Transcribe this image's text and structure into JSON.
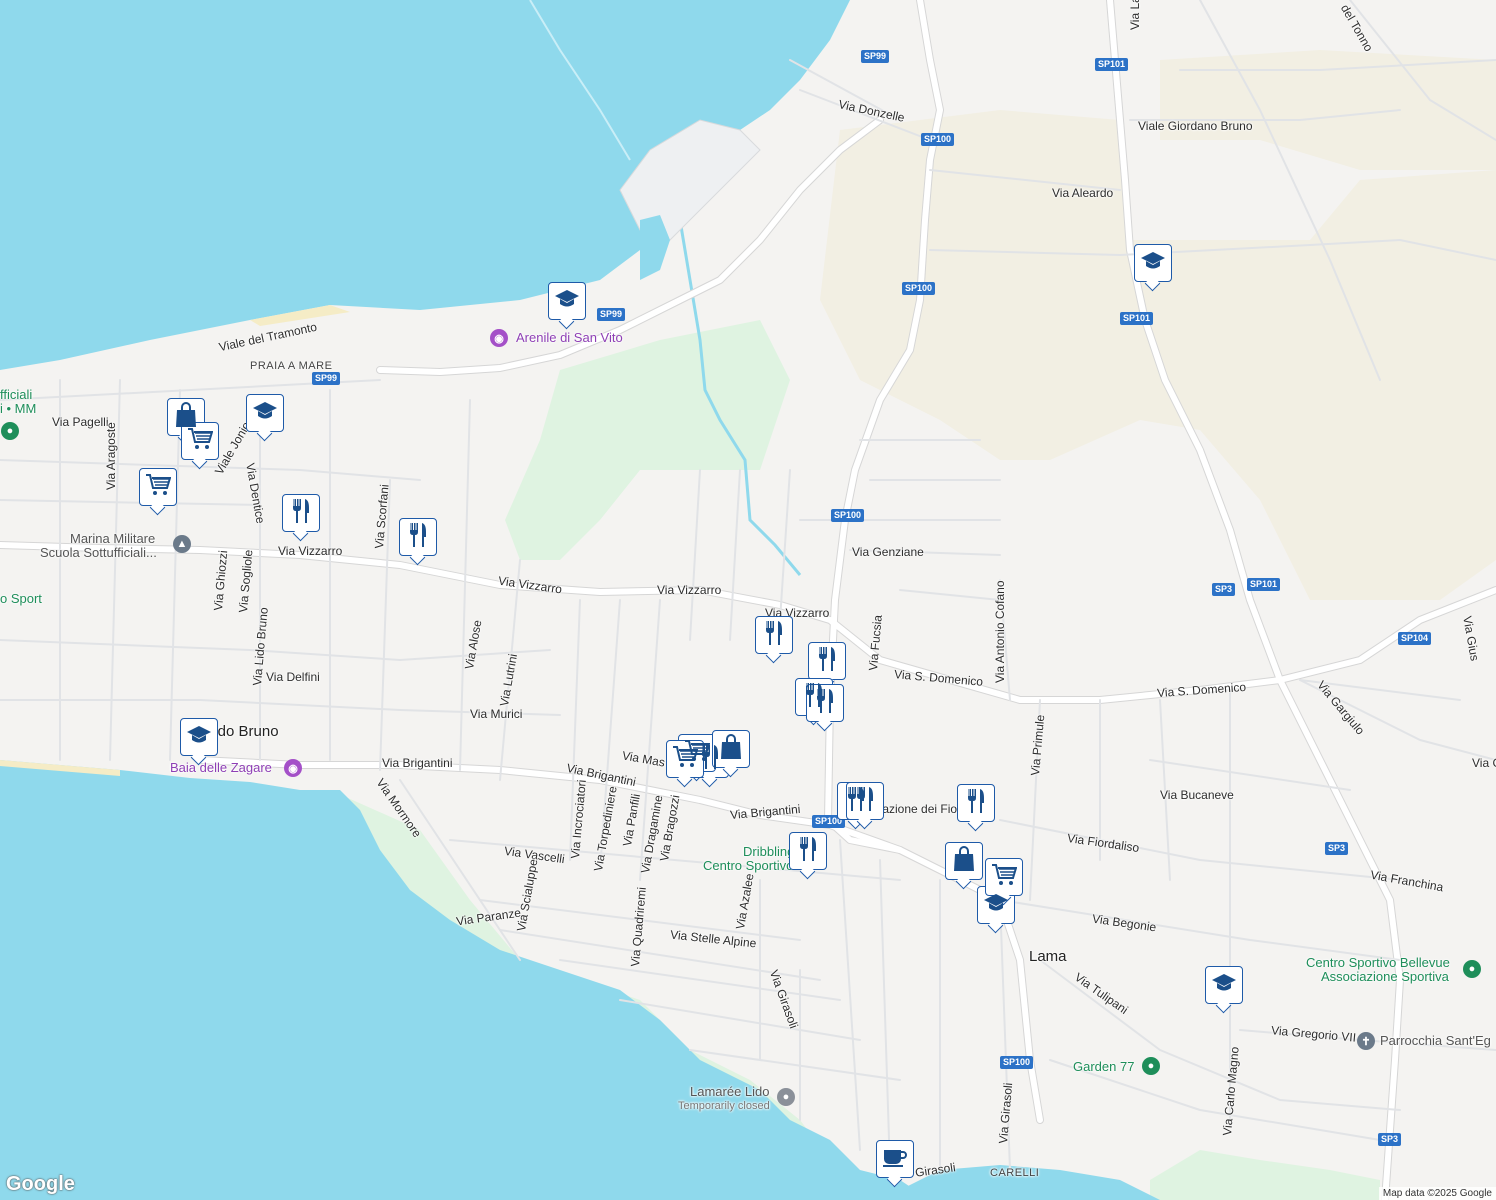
{
  "map": {
    "attribution": "Map data ©2025 Google",
    "logo": "Google",
    "colors": {
      "water": "#8fd9ec",
      "land": "#f4f3f1",
      "park": "#dff3e1",
      "farmland": "#f2efe3",
      "road": "#ffffff",
      "shield": "#2c72c7",
      "marker_border": "#1e5aa8"
    },
    "shields": {
      "sp99_a": "SP99",
      "sp99_b": "SP99",
      "sp99_c": "SP99",
      "sp100_a": "SP100",
      "sp100_b": "SP100",
      "sp100_c": "SP100",
      "sp100_d": "SP100",
      "sp100_e": "SP100",
      "sp101_a": "SP101",
      "sp101_b": "SP101",
      "sp101_c": "SP101",
      "sp3_a": "SP3",
      "sp3_b": "SP3",
      "sp3_c": "SP3",
      "sp104": "SP104"
    },
    "streets": {
      "donzelle": "Via Donzelle",
      "giordano_bruno": "Viale Giordano Bruno",
      "aleardo": "Via Aleardo",
      "lago": "Via Lago di L",
      "tonno": "del Tonno",
      "tramonto": "Viale del Tramonto",
      "pagelli": "Via Pagelli",
      "aragoste": "Via Aragoste",
      "jonio": "Viale Jonio",
      "dentice": "Via Dentice",
      "scorfani": "Via Scorfani",
      "vizzarro1": "Via Vizzarro",
      "vizzarro2": "Via Vizzarro",
      "vizzarro3": "Via Vizzarro",
      "vizzarro4": "Via Vizzarro",
      "genziane": "Via Genziane",
      "antonio_cofano": "Via Antonio Cofano",
      "fucsia": "Via Fucsia",
      "sdomenico1": "Via S. Domenico",
      "sdomenico2": "Via S. Domenico",
      "gargiulo": "Via Gargiulo",
      "ghiozzi": "Via Ghiozzi",
      "sogliole": "Via Sogliole",
      "lido_bruno": "Via Lido Bruno",
      "delfini": "Via Delfini",
      "alose": "Via Alose",
      "lutrini": "Via Lutrini",
      "murici": "Via Murici",
      "brigantini1": "Via Brigantini",
      "brigantini2": "Via Brigantini",
      "brigantini3": "Via Brigantini",
      "mas": "Via Mas",
      "primule": "Via Primule",
      "bucaneve": "Via Bucaneve",
      "mormore": "Via Mormore",
      "incrociatori": "Via Incrociatori",
      "torpediniere": "Via Torpediniere",
      "panfili": "Via Panfili",
      "dragamine": "Via Dragamine",
      "bragozzi": "Via Bragozzi",
      "fiori": "llazione dei Fio",
      "fiordaliso": "Via Fiordaliso",
      "vascelli": "Via Vascelli",
      "franchina": "Via Franchina",
      "begonie": "Via Begonie",
      "paranze": "Via Paranze",
      "scialuppe": "Via Scialuppe",
      "quadriremi": "Via Quadriremi",
      "stelle_alpine": "Via Stelle Alpine",
      "azalee": "Via Azalee",
      "girasoli1": "Via Girasoli",
      "girasoli2": "Via Girasoli",
      "girasoli3": "Girasoli",
      "tulipani": "Via Tulipani",
      "gregorio": "Via Gregorio VII",
      "carlo_magno": "Via Carlo Magno",
      "gius": "Via Gius",
      "via_g": "Via G"
    },
    "places": {
      "praia": "PRAIA A MARE",
      "lido_bruno": "Lido Bruno",
      "lama": "Lama",
      "carelli": "CARELLI"
    },
    "pois": {
      "arenile": "Arenile di San Vito",
      "baia": "Baia delle Zagare",
      "marina_line1": "Marina Militare",
      "marina_line2": "Scuola Sottufficiali...",
      "ufficiali_line1": "fficiali",
      "ufficiali_line2": "i • MM",
      "o_sport": "o Sport",
      "dribbling_line1": "Dribbling",
      "dribbling_line2": "Centro Sportivo",
      "bellevue_line1": "Centro Sportivo Bellevue",
      "bellevue_line2": "Associazione Sportiva",
      "parrocchia": "Parrocchia Sant'Eg",
      "garden": "Garden 77",
      "lamaree": "Lamarée Lido",
      "lamaree_status": "Temporarily closed"
    },
    "markers": [
      {
        "icon": "school-icon"
      },
      {
        "icon": "school-icon"
      },
      {
        "icon": "school-icon"
      },
      {
        "icon": "school-icon"
      },
      {
        "icon": "school-icon"
      },
      {
        "icon": "shopping-bag-icon"
      },
      {
        "icon": "shopping-cart-icon"
      },
      {
        "icon": "shopping-cart-icon"
      },
      {
        "icon": "restaurant-icon"
      },
      {
        "icon": "restaurant-icon"
      },
      {
        "icon": "restaurant-icon"
      },
      {
        "icon": "restaurant-icon"
      },
      {
        "icon": "restaurant-icon"
      },
      {
        "icon": "restaurant-icon"
      },
      {
        "icon": "restaurant-icon"
      },
      {
        "icon": "restaurant-icon"
      },
      {
        "icon": "restaurant-icon"
      },
      {
        "icon": "restaurant-icon"
      },
      {
        "icon": "restaurant-icon"
      },
      {
        "icon": "shopping-cart-icon"
      },
      {
        "icon": "shopping-bag-icon"
      },
      {
        "icon": "shopping-cart-icon"
      },
      {
        "icon": "shopping-bag-icon"
      },
      {
        "icon": "shopping-cart-icon"
      },
      {
        "icon": "coffee-icon"
      },
      {
        "icon": "school-icon"
      }
    ]
  }
}
